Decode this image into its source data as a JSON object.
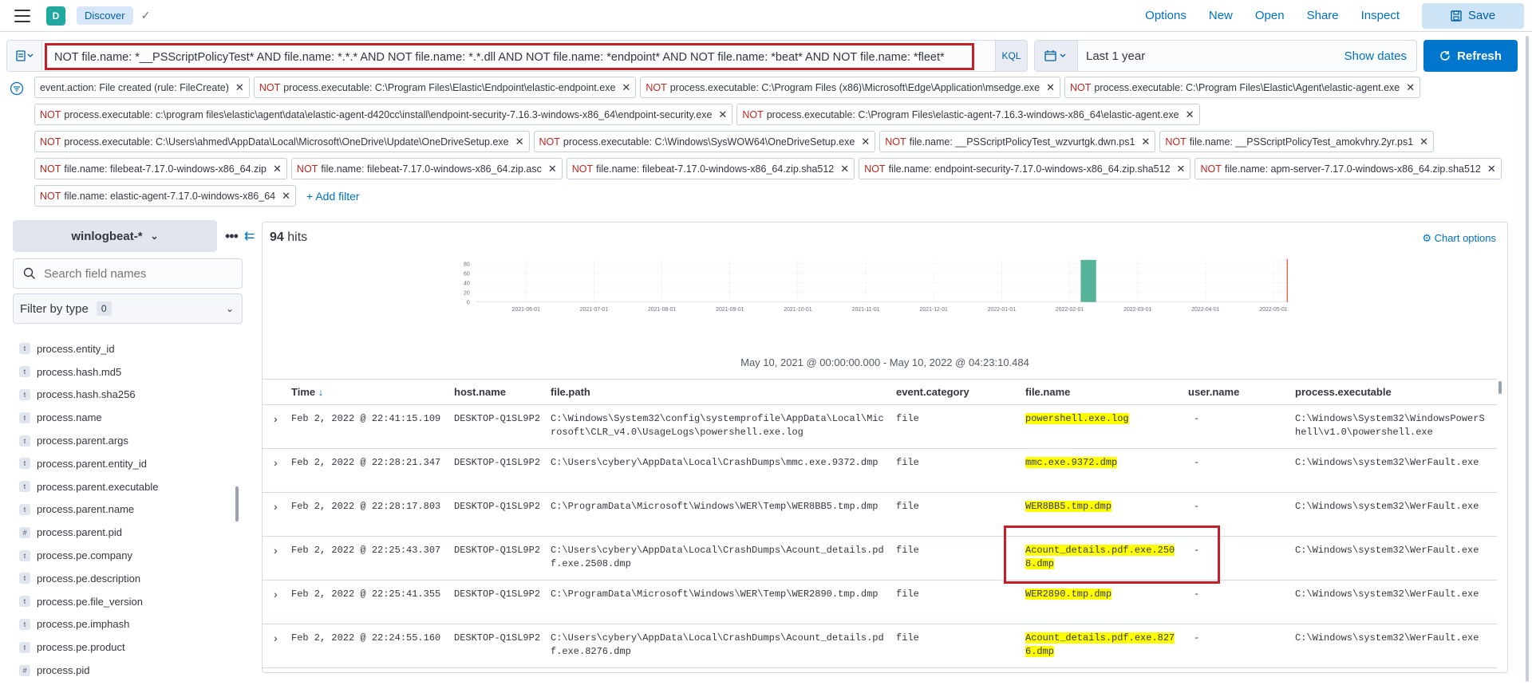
{
  "topbar": {
    "avatar": "D",
    "breadcrumb": "Discover",
    "actions": [
      "Options",
      "New",
      "Open",
      "Share",
      "Inspect"
    ],
    "save_label": "Save"
  },
  "query": {
    "text": "NOT file.name: *__PSScriptPolicyTest* AND file.name: *.*.* AND NOT file.name: *.*.dll AND NOT file.name: *endpoint* AND NOT file.name: *beat* AND NOT file.name: *fleet*",
    "language": "KQL",
    "date_range": "Last 1 year",
    "show_dates": "Show dates",
    "refresh_label": "Refresh"
  },
  "filters": [
    {
      "neg": "",
      "text": "event.action: File created (rule: FileCreate)"
    },
    {
      "neg": "NOT",
      "text": "process.executable: C:\\Program Files\\Elastic\\Endpoint\\elastic-endpoint.exe"
    },
    {
      "neg": "NOT",
      "text": "process.executable: C:\\Program Files (x86)\\Microsoft\\Edge\\Application\\msedge.exe"
    },
    {
      "neg": "NOT",
      "text": "process.executable: C:\\Program Files\\Elastic\\Agent\\elastic-agent.exe"
    },
    {
      "neg": "NOT",
      "text": "process.executable: c:\\program files\\elastic\\agent\\data\\elastic-agent-d420cc\\install\\endpoint-security-7.16.3-windows-x86_64\\endpoint-security.exe"
    },
    {
      "neg": "NOT",
      "text": "process.executable: C:\\Program Files\\elastic-agent-7.16.3-windows-x86_64\\elastic-agent.exe"
    },
    {
      "neg": "NOT",
      "text": "process.executable: C:\\Users\\ahmed\\AppData\\Local\\Microsoft\\OneDrive\\Update\\OneDriveSetup.exe"
    },
    {
      "neg": "NOT",
      "text": "process.executable: C:\\Windows\\SysWOW64\\OneDriveSetup.exe"
    },
    {
      "neg": "NOT",
      "text": "file.name: __PSScriptPolicyTest_wzvurtgk.dwn.ps1"
    },
    {
      "neg": "NOT",
      "text": "file.name: __PSScriptPolicyTest_amokvhry.2yr.ps1"
    },
    {
      "neg": "NOT",
      "text": "file.name: filebeat-7.17.0-windows-x86_64.zip"
    },
    {
      "neg": "NOT",
      "text": "file.name: filebeat-7.17.0-windows-x86_64.zip.asc"
    },
    {
      "neg": "NOT",
      "text": "file.name: filebeat-7.17.0-windows-x86_64.zip.sha512"
    },
    {
      "neg": "NOT",
      "text": "file.name: endpoint-security-7.17.0-windows-x86_64.zip.sha512"
    },
    {
      "neg": "NOT",
      "text": "file.name: apm-server-7.17.0-windows-x86_64.zip.sha512"
    },
    {
      "neg": "NOT",
      "text": "file.name: elastic-agent-7.17.0-windows-x86_64"
    }
  ],
  "add_filter": "+ Add filter",
  "sidebar": {
    "index_pattern": "winlogbeat-*",
    "search_placeholder": "Search field names",
    "filter_by_type": "Filter by type",
    "filter_count": "0",
    "fields": [
      {
        "type": "t",
        "name": "process.entity_id"
      },
      {
        "type": "t",
        "name": "process.hash.md5"
      },
      {
        "type": "t",
        "name": "process.hash.sha256"
      },
      {
        "type": "t",
        "name": "process.name"
      },
      {
        "type": "t",
        "name": "process.parent.args"
      },
      {
        "type": "t",
        "name": "process.parent.entity_id"
      },
      {
        "type": "t",
        "name": "process.parent.executable"
      },
      {
        "type": "t",
        "name": "process.parent.name"
      },
      {
        "type": "#",
        "name": "process.parent.pid"
      },
      {
        "type": "t",
        "name": "process.pe.company"
      },
      {
        "type": "t",
        "name": "process.pe.description"
      },
      {
        "type": "t",
        "name": "process.pe.file_version"
      },
      {
        "type": "t",
        "name": "process.pe.imphash"
      },
      {
        "type": "t",
        "name": "process.pe.product"
      },
      {
        "type": "#",
        "name": "process.pid"
      }
    ]
  },
  "hits": {
    "count": "94",
    "label": " hits"
  },
  "chart_options": "Chart options",
  "chart_data": {
    "type": "bar",
    "y_ticks": [
      "80",
      "60",
      "40",
      "20",
      "0"
    ],
    "ylim": [
      0,
      90
    ],
    "x_ticks": [
      "2021-06-01",
      "2021-07-01",
      "2021-08-01",
      "2021-09-01",
      "2021-10-01",
      "2021-11-01",
      "2021-12-01",
      "2022-01-01",
      "2022-02-01",
      "2022-03-01",
      "2022-04-01",
      "2022-05-01"
    ],
    "bars": [
      {
        "x": "2022-02-01",
        "value": 88,
        "color": "#54b399"
      }
    ],
    "current_marker_color": "#e7664c",
    "grid": true
  },
  "date_range_label": "May 10, 2021 @ 00:00:00.000 - May 10, 2022 @ 04:23:10.484",
  "table": {
    "columns": [
      "Time",
      "host.name",
      "file.path",
      "event.category",
      "file.name",
      "user.name",
      "process.executable"
    ],
    "sort_icon": "↓",
    "rows": [
      {
        "time": "Feb 2, 2022 @ 22:41:15.109",
        "host": "DESKTOP-Q1SL9P2",
        "path": "C:\\Windows\\System32\\config\\systemprofile\\AppData\\Local\\Microsoft\\CLR_v4.0\\UsageLogs\\powershell.exe.log",
        "category": "file",
        "file": "powershell.exe.log",
        "user": "-",
        "proc": "C:\\Windows\\System32\\WindowsPowerShell\\v1.0\\powershell.exe"
      },
      {
        "time": "Feb 2, 2022 @ 22:28:21.347",
        "host": "DESKTOP-Q1SL9P2",
        "path": "C:\\Users\\cybery\\AppData\\Local\\CrashDumps\\mmc.exe.9372.dmp",
        "category": "file",
        "file": "mmc.exe.9372.dmp",
        "user": "-",
        "proc": "C:\\Windows\\system32\\WerFault.exe"
      },
      {
        "time": "Feb 2, 2022 @ 22:28:17.803",
        "host": "DESKTOP-Q1SL9P2",
        "path": "C:\\ProgramData\\Microsoft\\Windows\\WER\\Temp\\WER8BB5.tmp.dmp",
        "category": "file",
        "file": "WER8BB5.tmp.dmp",
        "user": "-",
        "proc": "C:\\Windows\\system32\\WerFault.exe"
      },
      {
        "time": "Feb 2, 2022 @ 22:25:43.307",
        "host": "DESKTOP-Q1SL9P2",
        "path": "C:\\Users\\cybery\\AppData\\Local\\CrashDumps\\Acount_details.pdf.exe.2508.dmp",
        "category": "file",
        "file": "Acount_details.pdf.exe.2508.dmp",
        "user": "-",
        "proc": "C:\\Windows\\system32\\WerFault.exe"
      },
      {
        "time": "Feb 2, 2022 @ 22:25:41.355",
        "host": "DESKTOP-Q1SL9P2",
        "path": "C:\\ProgramData\\Microsoft\\Windows\\WER\\Temp\\WER2890.tmp.dmp",
        "category": "file",
        "file": "WER2890.tmp.dmp",
        "user": "-",
        "proc": "C:\\Windows\\system32\\WerFault.exe"
      },
      {
        "time": "Feb 2, 2022 @ 22:24:55.160",
        "host": "DESKTOP-Q1SL9P2",
        "path": "C:\\Users\\cybery\\AppData\\Local\\CrashDumps\\Acount_details.pdf.exe.8276.dmp",
        "category": "file",
        "file": "Acount_details.pdf.exe.8276.dmp",
        "user": "-",
        "proc": "C:\\Windows\\system32\\WerFault.exe"
      }
    ]
  }
}
